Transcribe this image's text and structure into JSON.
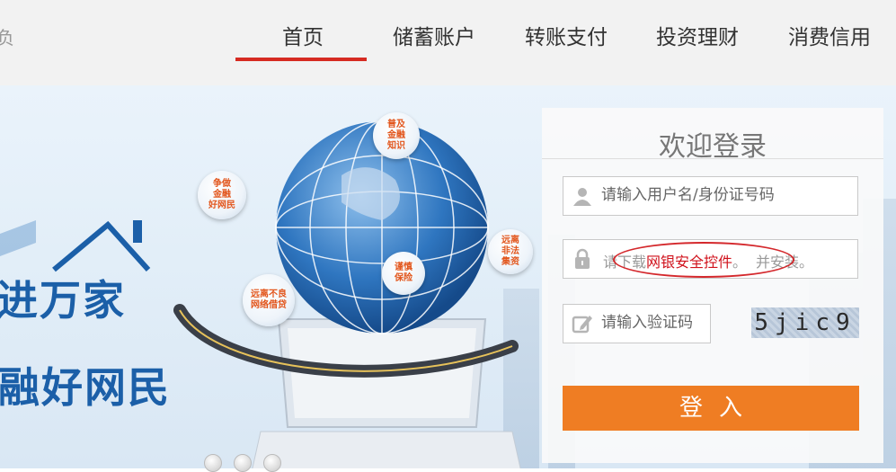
{
  "nav": {
    "brand_fragment": "负",
    "tabs": [
      {
        "label": "首页",
        "active": true
      },
      {
        "label": "储蓄账户",
        "active": false
      },
      {
        "label": "转账支付",
        "active": false
      },
      {
        "label": "投资理财",
        "active": false
      },
      {
        "label": "消费信用",
        "active": false
      }
    ],
    "active_color": "#d62b22"
  },
  "banner": {
    "slogan_line1": "进万家",
    "slogan_line2": "融好网民",
    "bubbles": [
      "普及\n金融\n知识",
      "争做\n金融\n好网民",
      "远离\n非法\n集资",
      "谨慎\n保险",
      "远离不良\n网络借贷"
    ],
    "carousel_dots": 3
  },
  "login": {
    "title": "欢迎登录",
    "username_placeholder": "请输入用户名/身份证号码",
    "password_hint_prefix": "请下载",
    "password_hint_link": "网银安全控件",
    "password_hint_suffix": "。",
    "password_hint_tail": "并安装。",
    "captcha_placeholder": "请输入验证码",
    "captcha_text": "5jic9",
    "submit_label": "登入",
    "submit_color": "#ef7d23"
  }
}
